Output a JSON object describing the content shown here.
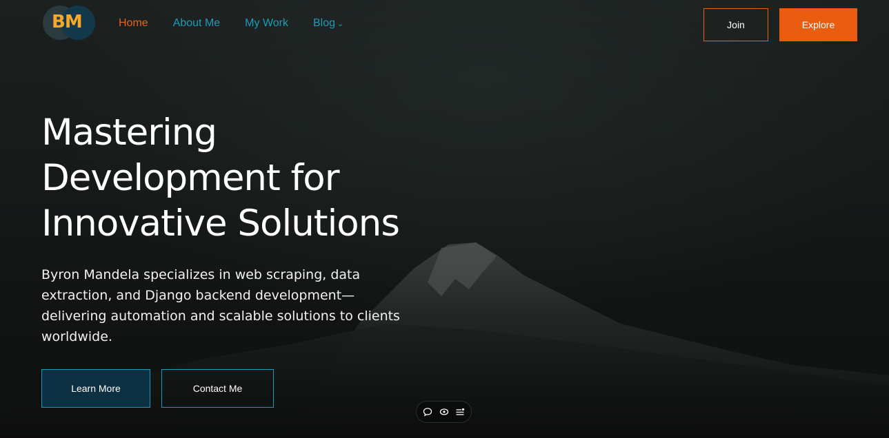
{
  "logo": {
    "text": "BM"
  },
  "nav": {
    "items": [
      {
        "label": "Home",
        "active": true
      },
      {
        "label": "About Me",
        "active": false
      },
      {
        "label": "My Work",
        "active": false
      },
      {
        "label": "Blog",
        "active": false,
        "has_dropdown": true
      }
    ],
    "join_label": "Join",
    "explore_label": "Explore"
  },
  "hero": {
    "title_lines": [
      "Mastering",
      "Development for",
      "Innovative Solutions"
    ],
    "description_lines": [
      "Byron Mandela specializes in web scraping, data",
      "extraction, and Django backend development—",
      "delivering automation and scalable solutions to clients",
      "worldwide."
    ],
    "learn_more_label": "Learn More",
    "contact_label": "Contact Me"
  },
  "floating_toolbar": {
    "icons": [
      "chat-bubble-icon",
      "eye-icon",
      "list-menu-icon"
    ]
  },
  "colors": {
    "accent_orange": "#ea5c10",
    "accent_teal": "#1e9bb9",
    "logo_gold": "#f5a82a",
    "background": "#141716"
  }
}
